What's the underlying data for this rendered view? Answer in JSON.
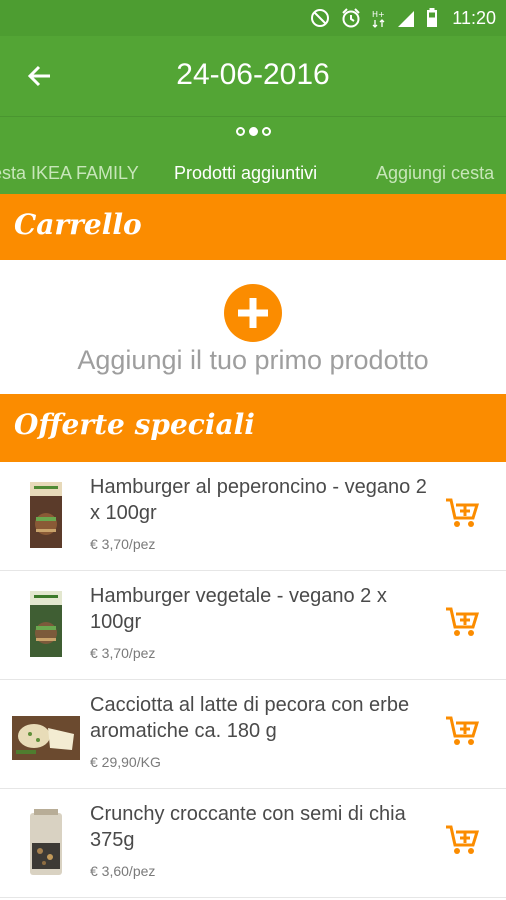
{
  "status_bar": {
    "time": "11:20",
    "icons": [
      "do-not-disturb-icon",
      "alarm-icon",
      "hplus-signal-icon",
      "cell-signal-icon",
      "battery-icon"
    ],
    "color": "#4d9d31"
  },
  "app_bar": {
    "title": "24-06-2016",
    "back_icon": "back-arrow-icon",
    "color": "#53a535"
  },
  "pager": {
    "dots": 3,
    "active_index": 1,
    "tabs": [
      {
        "label": "esta IKEA FAMILY",
        "active": false
      },
      {
        "label": "Prodotti aggiuntivi",
        "active": true
      },
      {
        "label": "Aggiungi cesta",
        "active": false
      }
    ]
  },
  "cart": {
    "header": "Carrello",
    "add_icon": "add-circle-icon",
    "empty_text": "Aggiungi il tuo primo prodotto"
  },
  "offers": {
    "header": "Offerte speciali",
    "items": [
      {
        "name": "Hamburger al peperoncino - vegano 2 x 100gr",
        "price": "€ 3,70/pez",
        "icon": "add-to-cart-icon"
      },
      {
        "name": "Hamburger vegetale - vegano 2 x 100gr",
        "price": "€ 3,70/pez",
        "icon": "add-to-cart-icon"
      },
      {
        "name": "Cacciotta al latte di pecora con erbe aromatiche ca. 180 g",
        "price": "€ 29,90/KG",
        "icon": "add-to-cart-icon"
      },
      {
        "name": "Crunchy croccante con semi di chia 375g",
        "price": "€ 3,60/pez",
        "icon": "add-to-cart-icon"
      }
    ]
  },
  "colors": {
    "accent": "#fb8c00",
    "muted_text": "#9e9e9e"
  }
}
